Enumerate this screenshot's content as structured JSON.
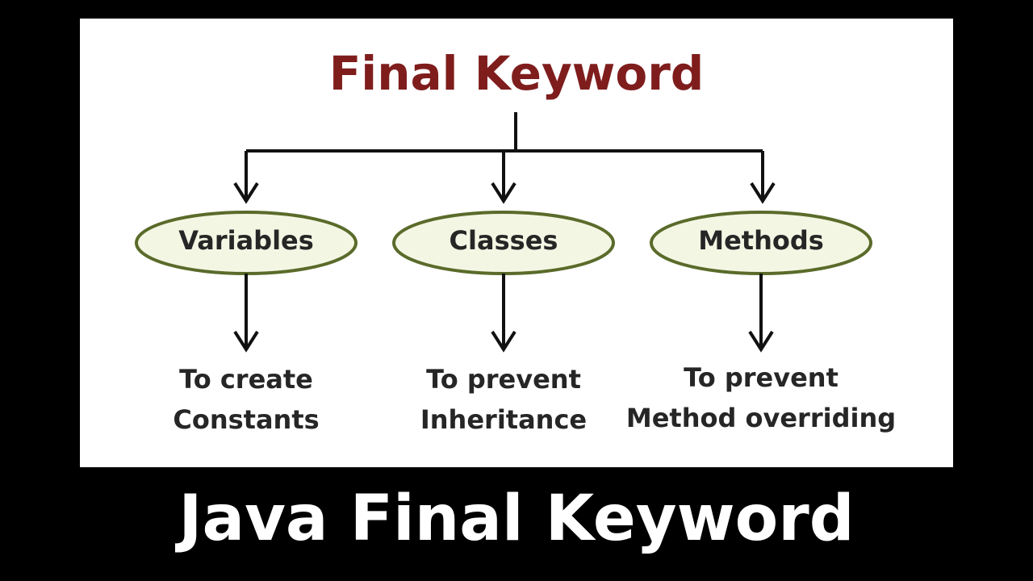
{
  "diagram": {
    "title": "Final Keyword",
    "nodes": [
      {
        "label": "Variables",
        "outcome": [
          "To create",
          "Constants"
        ]
      },
      {
        "label": "Classes",
        "outcome": [
          "To prevent",
          "Inheritance"
        ]
      },
      {
        "label": "Methods",
        "outcome": [
          "To prevent",
          "Method overriding"
        ]
      }
    ]
  },
  "caption": "Java Final Keyword",
  "colors": {
    "title": "#7f1d1d",
    "ellipse_fill": "#f4f6e4",
    "ellipse_stroke": "#5a6b2a",
    "arrow": "#111111",
    "caption": "#ffffff"
  }
}
